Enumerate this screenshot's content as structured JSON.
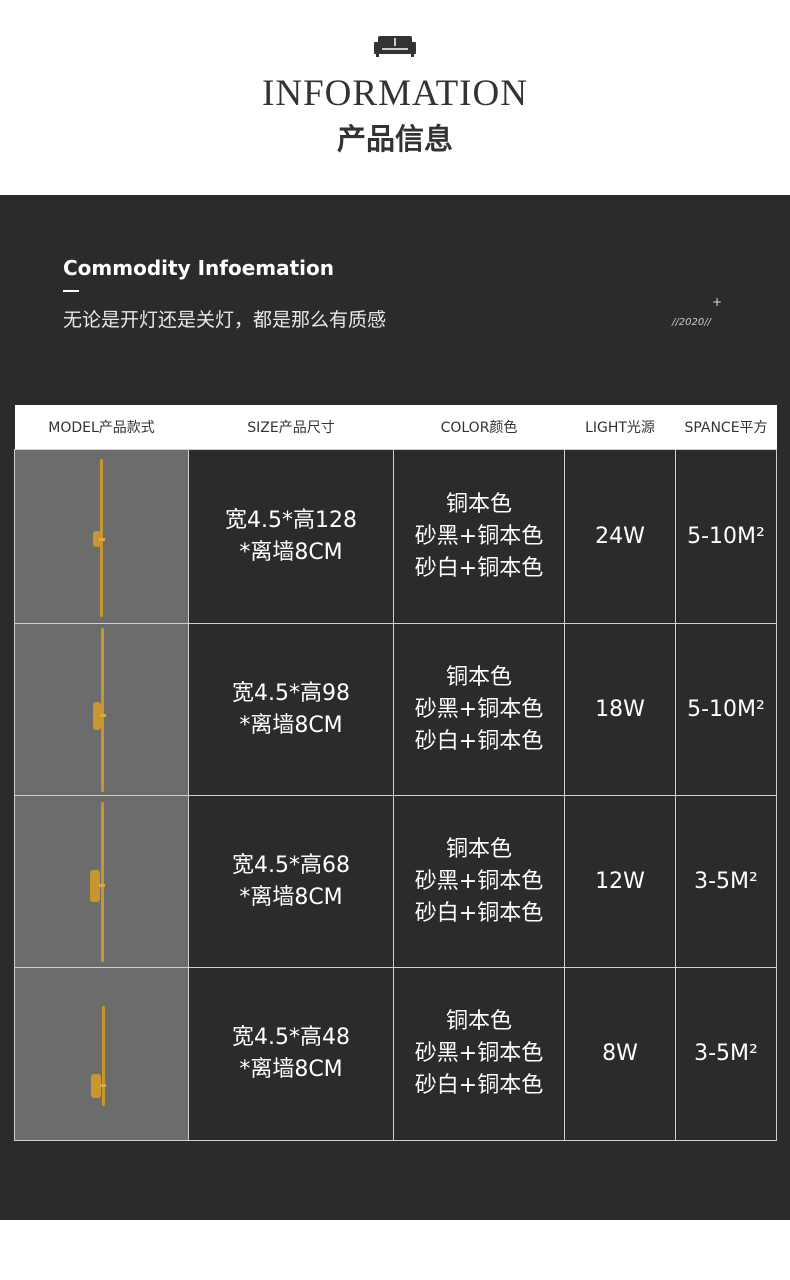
{
  "header": {
    "icon": "sofa-icon",
    "title_en": "INFORMATION",
    "title_cn": "产品信息"
  },
  "section": {
    "title": "Commodity Infoemation",
    "tagline": "无论是开灯还是关灯，都是那么有质感",
    "plus": "+",
    "year": "//2020//"
  },
  "table": {
    "headers": [
      "MODEL产品款式",
      "SIZE产品尺寸",
      "COLOR颜色",
      "LIGHT光源",
      "SPANCE平方"
    ],
    "rows": [
      {
        "size_line1": "宽4.5*高128",
        "size_line2": "*离墙8CM",
        "color_1": "铜本色",
        "color_2": "砂黑+铜本色",
        "color_3": "砂白+铜本色",
        "light": "24W",
        "space": "5-10M²"
      },
      {
        "size_line1": "宽4.5*高98",
        "size_line2": "*离墙8CM",
        "color_1": "铜本色",
        "color_2": "砂黑+铜本色",
        "color_3": "砂白+铜本色",
        "light": "18W",
        "space": "5-10M²"
      },
      {
        "size_line1": "宽4.5*高68",
        "size_line2": "*离墙8CM",
        "color_1": "铜本色",
        "color_2": "砂黑+铜本色",
        "color_3": "砂白+铜本色",
        "light": "12W",
        "space": "3-5M²"
      },
      {
        "size_line1": "宽4.5*高48",
        "size_line2": "*离墙8CM",
        "color_1": "铜本色",
        "color_2": "砂黑+铜本色",
        "color_3": "砂白+铜本色",
        "light": "8W",
        "space": "3-5M²"
      }
    ]
  },
  "colors": {
    "dark_bg": "#2b2b2b",
    "image_bg": "#6c6c6c",
    "brass": "#c8962f"
  }
}
